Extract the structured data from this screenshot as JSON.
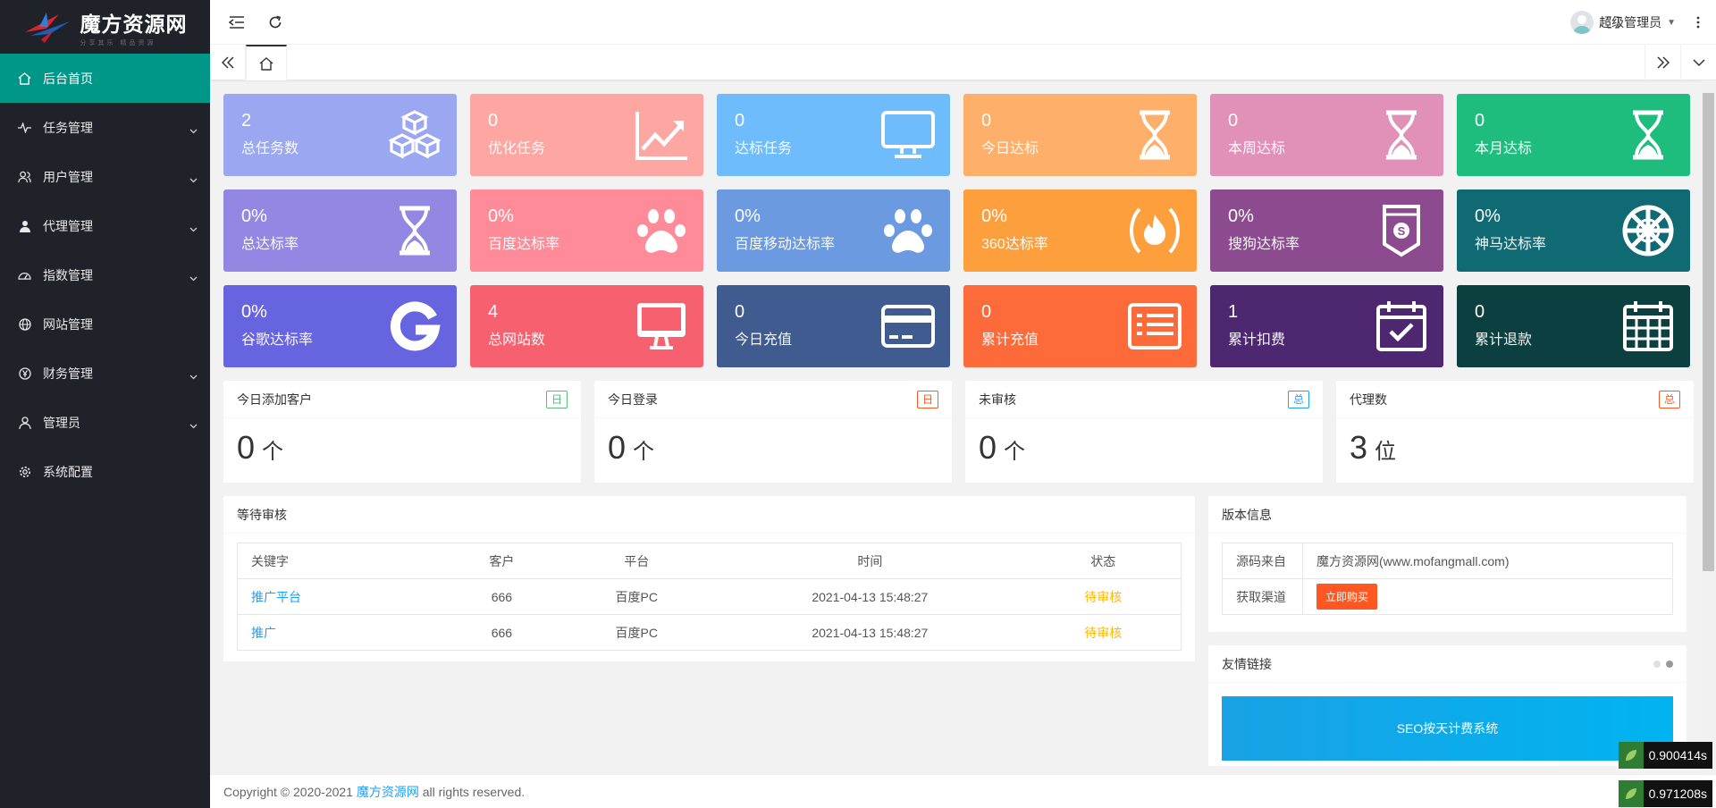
{
  "brand": {
    "title": "魔方资源网",
    "subtitle": "分享其乐 精品资源"
  },
  "sidebar": {
    "items": [
      {
        "label": "后台首页",
        "icon": "home-icon",
        "active": true,
        "has_children": false
      },
      {
        "label": "任务管理",
        "icon": "pulse-icon",
        "has_children": true
      },
      {
        "label": "用户管理",
        "icon": "users-icon",
        "has_children": true
      },
      {
        "label": "代理管理",
        "icon": "user-icon",
        "has_children": true
      },
      {
        "label": "指数管理",
        "icon": "gauge-icon",
        "has_children": true
      },
      {
        "label": "网站管理",
        "icon": "globe-icon",
        "has_children": false
      },
      {
        "label": "财务管理",
        "icon": "yen-icon",
        "has_children": true
      },
      {
        "label": "管理员",
        "icon": "admin-icon",
        "has_children": true
      },
      {
        "label": "系统配置",
        "icon": "gear-icon",
        "has_children": false
      }
    ]
  },
  "header": {
    "user_name": "超级管理员"
  },
  "stats": [
    {
      "value": "2",
      "label": "总任务数",
      "color": "#9ba7f0",
      "icon": "cubes-icon"
    },
    {
      "value": "0",
      "label": "优化任务",
      "color": "#fea6a2",
      "icon": "chart-up-icon"
    },
    {
      "value": "0",
      "label": "达标任务",
      "color": "#6fbcfd",
      "icon": "monitor-icon"
    },
    {
      "value": "0",
      "label": "今日达标",
      "color": "#feaf6a",
      "icon": "hourglass-icon"
    },
    {
      "value": "0",
      "label": "本周达标",
      "color": "#e190b8",
      "icon": "hourglass-icon"
    },
    {
      "value": "0",
      "label": "本月达标",
      "color": "#1ebd7d",
      "icon": "hourglass-icon"
    },
    {
      "value": "0%",
      "label": "总达标率",
      "color": "#9288e3",
      "icon": "hourglass-icon"
    },
    {
      "value": "0%",
      "label": "百度达标率",
      "color": "#fe8b97",
      "icon": "paw-icon"
    },
    {
      "value": "0%",
      "label": "百度移动达标率",
      "color": "#6c9ae0",
      "icon": "paw-icon"
    },
    {
      "value": "0%",
      "label": "360达标率",
      "color": "#fe9f3d",
      "icon": "fire-icon"
    },
    {
      "value": "0%",
      "label": "搜狗达标率",
      "color": "#8b4b8e",
      "icon": "badge-s-icon"
    },
    {
      "value": "0%",
      "label": "神马达标率",
      "color": "#0f6a74",
      "icon": "wheel-icon"
    },
    {
      "value": "0%",
      "label": "谷歌达标率",
      "color": "#6764e0",
      "icon": "google-icon"
    },
    {
      "value": "4",
      "label": "总网站数",
      "color": "#f6606f",
      "icon": "desktop-icon"
    },
    {
      "value": "0",
      "label": "今日充值",
      "color": "#3f5b90",
      "icon": "credit-card-icon"
    },
    {
      "value": "0",
      "label": "累计充值",
      "color": "#fe6b3b",
      "icon": "list-icon"
    },
    {
      "value": "1",
      "label": "累计扣费",
      "color": "#4d2870",
      "icon": "calendar-check-icon"
    },
    {
      "value": "0",
      "label": "累计退款",
      "color": "#0c3f3f",
      "icon": "calendar-icon"
    }
  ],
  "counters": [
    {
      "title": "今日添加客户",
      "badge": "日",
      "badge_color": "#5fb878",
      "value": "0",
      "unit": "个"
    },
    {
      "title": "今日登录",
      "badge": "日",
      "badge_color": "#ff5722",
      "value": "0",
      "unit": "个"
    },
    {
      "title": "未审核",
      "badge": "总",
      "badge_color": "#1e9fff",
      "value": "0",
      "unit": "个"
    },
    {
      "title": "代理数",
      "badge": "总",
      "badge_color": "#ff5722",
      "value": "3",
      "unit": "位"
    }
  ],
  "pending": {
    "title": "等待审核",
    "columns": [
      "关键字",
      "客户",
      "平台",
      "时间",
      "状态"
    ],
    "rows": [
      {
        "keyword": "推广平台",
        "customer": "666",
        "platform": "百度PC",
        "time": "2021-04-13 15:48:27",
        "status": "待审核"
      },
      {
        "keyword": "推广",
        "customer": "666",
        "platform": "百度PC",
        "time": "2021-04-13 15:48:27",
        "status": "待审核"
      }
    ]
  },
  "version": {
    "title": "版本信息",
    "source_label": "源码来自",
    "source_value": "魔方资源网(www.mofangmall.com)",
    "channel_label": "获取渠道",
    "buy_label": "立即购买"
  },
  "links": {
    "title": "友情链接",
    "banner": "SEO按天计费系统"
  },
  "footer": {
    "prefix": "Copyright © 2020-2021 ",
    "link": "魔方资源网",
    "suffix": " all rights reserved."
  },
  "perf": [
    "0.900414s",
    "0.971208s"
  ]
}
